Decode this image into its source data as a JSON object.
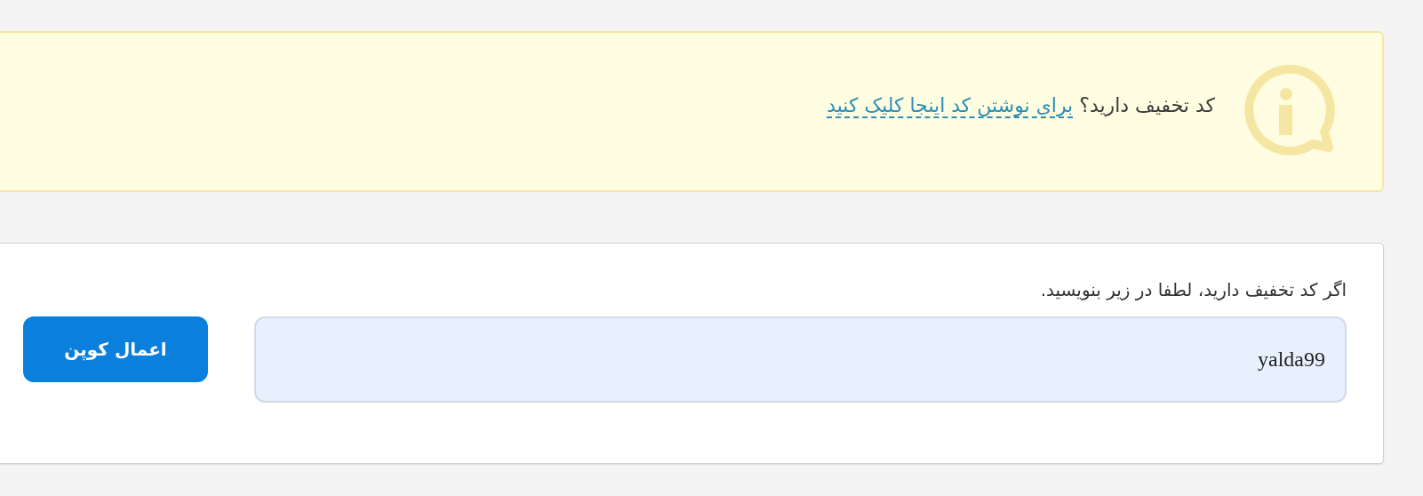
{
  "notice": {
    "text": "کد تخفیف دارید؟",
    "link": "برای نوشتن کد اینجا کلیک کنید"
  },
  "coupon_form": {
    "label": "اگر کد تخفیف دارید، لطفا در زیر بنویسید.",
    "input": {
      "value": "yalda99"
    },
    "button": "اعمال کوپن"
  }
}
